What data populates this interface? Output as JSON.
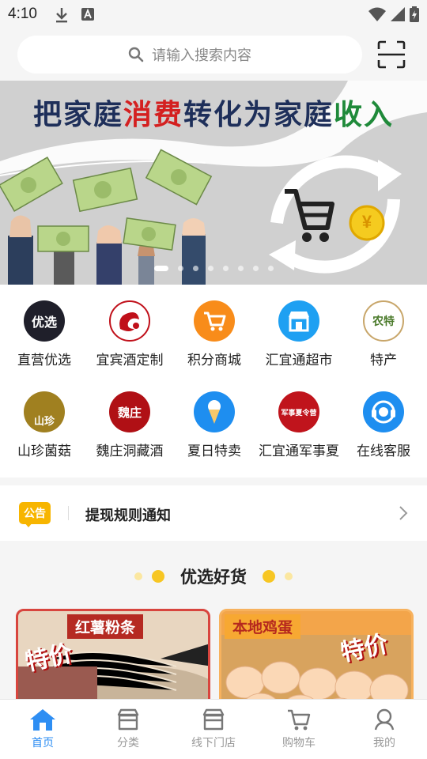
{
  "status_bar": {
    "time": "4:10"
  },
  "search": {
    "placeholder": "请输入搜索内容"
  },
  "banner": {
    "title_parts": [
      {
        "text": "把家庭",
        "color": "#1e2f5a"
      },
      {
        "text": "消费",
        "color": "#d42020"
      },
      {
        "text": "转化为家庭",
        "color": "#1e2f5a"
      },
      {
        "text": "收入",
        "color": "#1f8a3a"
      }
    ],
    "coin_symbol": "¥",
    "slide_count": 8,
    "active_slide": 1
  },
  "categories": [
    {
      "label": "直营优选",
      "icon_text": "优选"
    },
    {
      "label": "宜宾酒定制",
      "icon_text": ""
    },
    {
      "label": "积分商城",
      "icon_text": ""
    },
    {
      "label": "汇宜通超市",
      "icon_text": ""
    },
    {
      "label": "特产",
      "icon_text": "农特"
    },
    {
      "label": "山珍菌菇",
      "icon_text": "山珍"
    },
    {
      "label": "魏庄洞藏酒",
      "icon_text": "魏庄"
    },
    {
      "label": "夏日特卖",
      "icon_text": ""
    },
    {
      "label": "汇宜通军事夏",
      "icon_text": "军事夏令营"
    },
    {
      "label": "在线客服",
      "icon_text": ""
    }
  ],
  "notice": {
    "badge": "公告",
    "text": "提现规则通知"
  },
  "section": {
    "title": "优选好货"
  },
  "products": [
    {
      "tag": "红薯粉条",
      "sale": "特价"
    },
    {
      "tag": "本地鸡蛋",
      "sale": "特价"
    }
  ],
  "tabs": [
    {
      "label": "首页",
      "icon": "home-icon"
    },
    {
      "label": "分类",
      "icon": "category-icon"
    },
    {
      "label": "线下门店",
      "icon": "store-icon"
    },
    {
      "label": "购物车",
      "icon": "cart-icon"
    },
    {
      "label": "我的",
      "icon": "profile-icon"
    }
  ],
  "colors": {
    "accent": "#2e8ef3",
    "notice": "#f7b500"
  }
}
